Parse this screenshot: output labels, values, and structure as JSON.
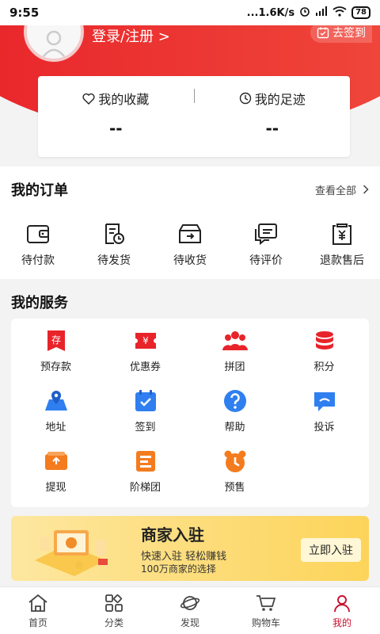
{
  "status_bar": {
    "time": "9:55",
    "network": "...1.6K/s",
    "battery": "78"
  },
  "header": {
    "login_label": "登录/注册 >",
    "signin_label": "去签到"
  },
  "fav_card": {
    "favorites_label": "我的收藏",
    "favorites_value": "--",
    "history_label": "我的足迹",
    "history_value": "--"
  },
  "orders": {
    "title": "我的订单",
    "view_all": "查看全部",
    "items": [
      {
        "label": "待付款",
        "icon": "wallet-icon"
      },
      {
        "label": "待发货",
        "icon": "doc-clock-icon"
      },
      {
        "label": "待收货",
        "icon": "box-icon"
      },
      {
        "label": "待评价",
        "icon": "chat-icon"
      },
      {
        "label": "退款售后",
        "icon": "refund-icon"
      }
    ]
  },
  "services": {
    "title": "我的服务",
    "items": [
      {
        "label": "预存款",
        "icon": "deposit-icon",
        "glyph": "存"
      },
      {
        "label": "优惠券",
        "icon": "coupon-icon",
        "glyph": "¥"
      },
      {
        "label": "拼团",
        "icon": "group-icon"
      },
      {
        "label": "积分",
        "icon": "coins-icon"
      },
      {
        "label": "地址",
        "icon": "map-icon"
      },
      {
        "label": "签到",
        "icon": "calendar-check-icon"
      },
      {
        "label": "帮助",
        "icon": "help-icon"
      },
      {
        "label": "投诉",
        "icon": "complaint-icon"
      },
      {
        "label": "提现",
        "icon": "withdraw-icon"
      },
      {
        "label": "阶梯团",
        "icon": "ladder-icon"
      },
      {
        "label": "预售",
        "icon": "alarm-icon"
      }
    ]
  },
  "banner": {
    "title": "商家入驻",
    "subtitle": "快速入驻 轻松赚钱",
    "note": "100万商家的选择",
    "cta": "立即入驻"
  },
  "tabbar": {
    "items": [
      {
        "label": "首页",
        "icon": "home-icon",
        "active": false
      },
      {
        "label": "分类",
        "icon": "category-icon",
        "active": false
      },
      {
        "label": "发现",
        "icon": "planet-icon",
        "active": false
      },
      {
        "label": "购物车",
        "icon": "cart-icon",
        "active": false
      },
      {
        "label": "我的",
        "icon": "user-icon",
        "active": true
      }
    ]
  },
  "colors": {
    "brand_red": "#e8232a",
    "blue": "#2f7ff0",
    "orange": "#f47c1e",
    "active_tab": "#c8102e"
  }
}
